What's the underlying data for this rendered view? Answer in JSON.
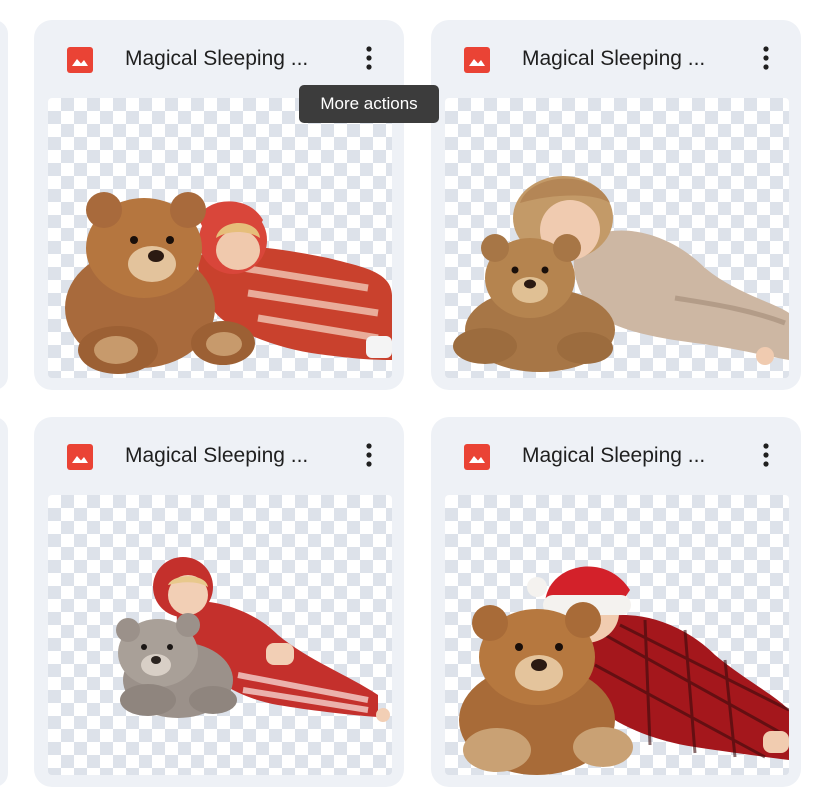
{
  "accent_icon_color": "#ea4335",
  "files": [
    {
      "title": "Magical Sleeping ...",
      "icon": "image-file-icon",
      "more_label": "More actions",
      "preview": "child in red and white striped pajamas hugging brown teddy bear"
    },
    {
      "title": "Magical Sleeping ...",
      "icon": "image-file-icon",
      "more_label": "More actions",
      "preview": "curly-haired child in beige pajamas sleeping on brown teddy bear"
    },
    {
      "title": "Magical Sleeping ...",
      "icon": "image-file-icon",
      "more_label": "More actions",
      "preview": "child in red hoodie pajamas with grey teddy bear"
    },
    {
      "title": "Magical Sleeping ...",
      "icon": "image-file-icon",
      "more_label": "More actions",
      "preview": "child in santa hat and red plaid pajamas with brown teddy bear"
    }
  ],
  "tooltip": {
    "text": "More actions"
  }
}
